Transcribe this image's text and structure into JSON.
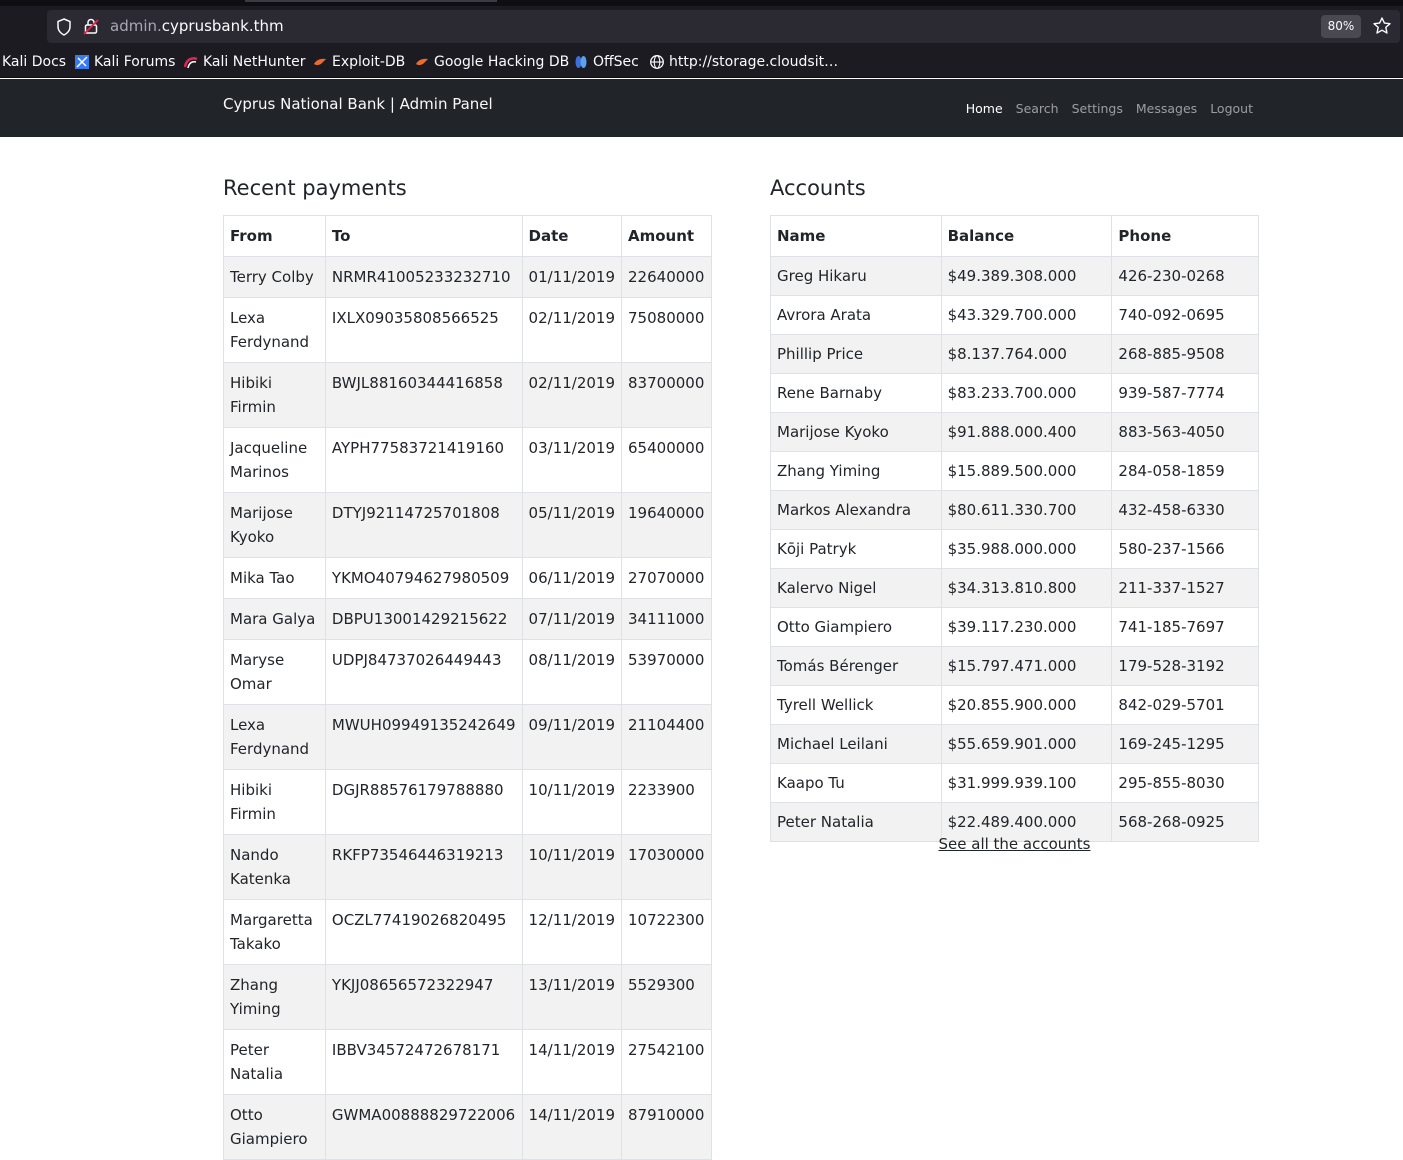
{
  "browser": {
    "url_prefix": "admin.",
    "url_domain": "cyprusbank.thm",
    "zoom": "80%",
    "bookmarks": [
      {
        "label": "Kali Docs",
        "icon": "kali-docs-icon"
      },
      {
        "label": "Kali Forums",
        "icon": "kali-forums-icon"
      },
      {
        "label": "Kali NetHunter",
        "icon": "kali-nethunter-icon"
      },
      {
        "label": "Exploit-DB",
        "icon": "exploit-db-icon"
      },
      {
        "label": "Google Hacking DB",
        "icon": "google-hacking-db-icon"
      },
      {
        "label": "OffSec",
        "icon": "offsec-icon"
      },
      {
        "label": "http://storage.cloudsit…",
        "icon": "globe-icon"
      }
    ]
  },
  "navbar": {
    "brand": "Cyprus National Bank | Admin Panel",
    "links": [
      "Home",
      "Search",
      "Settings",
      "Messages",
      "Logout"
    ],
    "active": "Home"
  },
  "payments": {
    "title": "Recent payments",
    "headers": [
      "From",
      "To",
      "Date",
      "Amount"
    ],
    "rows": [
      [
        "Terry Colby",
        "NRMR41005233232710",
        "01/11/2019",
        "22640000"
      ],
      [
        "Lexa Ferdynand",
        "IXLX09035808566525",
        "02/11/2019",
        "75080000"
      ],
      [
        "Hibiki Firmin",
        "BWJL88160344416858",
        "02/11/2019",
        "83700000"
      ],
      [
        "Jacqueline Marinos",
        "AYPH77583721419160",
        "03/11/2019",
        "65400000"
      ],
      [
        "Marijose Kyoko",
        "DTYJ92114725701808",
        "05/11/2019",
        "19640000"
      ],
      [
        "Mika Tao",
        "YKMO40794627980509",
        "06/11/2019",
        "27070000"
      ],
      [
        "Mara Galya",
        "DBPU13001429215622",
        "07/11/2019",
        "34111000"
      ],
      [
        "Maryse Omar",
        "UDPJ84737026449443",
        "08/11/2019",
        "53970000"
      ],
      [
        "Lexa Ferdynand",
        "MWUH09949135242649",
        "09/11/2019",
        "21104400"
      ],
      [
        "Hibiki Firmin",
        "DGJR88576179788880",
        "10/11/2019",
        "2233900"
      ],
      [
        "Nando Katenka",
        "RKFP73546446319213",
        "10/11/2019",
        "17030000"
      ],
      [
        "Margaretta Takako",
        "OCZL77419026820495",
        "12/11/2019",
        "10722300"
      ],
      [
        "Zhang Yiming",
        "YKJJ08656572322947",
        "13/11/2019",
        "5529300"
      ],
      [
        "Peter Natalia",
        "IBBV34572472678171",
        "14/11/2019",
        "27542100"
      ],
      [
        "Otto Giampiero",
        "GWMA00888829722006",
        "14/11/2019",
        "87910000"
      ]
    ]
  },
  "accounts": {
    "title": "Accounts",
    "headers": [
      "Name",
      "Balance",
      "Phone"
    ],
    "rows": [
      [
        "Greg Hikaru",
        "$49.389.308.000",
        "426-230-0268"
      ],
      [
        "Avrora Arata",
        "$43.329.700.000",
        "740-092-0695"
      ],
      [
        "Phillip Price",
        "$8.137.764.000",
        "268-885-9508"
      ],
      [
        "Rene Barnaby",
        "$83.233.700.000",
        "939-587-7774"
      ],
      [
        "Marijose Kyoko",
        "$91.888.000.400",
        "883-563-4050"
      ],
      [
        "Zhang Yiming",
        "$15.889.500.000",
        "284-058-1859"
      ],
      [
        "Markos Alexandra",
        "$80.611.330.700",
        "432-458-6330"
      ],
      [
        "Kōji Patryk",
        "$35.988.000.000",
        "580-237-1566"
      ],
      [
        "Kalervo Nigel",
        "$34.313.810.800",
        "211-337-1527"
      ],
      [
        "Otto Giampiero",
        "$39.117.230.000",
        "741-185-7697"
      ],
      [
        "Tomás Bérenger",
        "$15.797.471.000",
        "179-528-3192"
      ],
      [
        "Tyrell Wellick",
        "$20.855.900.000",
        "842-029-5701"
      ],
      [
        "Michael Leilani",
        "$55.659.901.000",
        "169-245-1295"
      ],
      [
        "Kaapo Tu",
        "$31.999.939.100",
        "295-855-8030"
      ],
      [
        "Peter Natalia",
        "$22.489.400.000",
        "568-268-0925"
      ]
    ],
    "see_all": "See all the accounts"
  }
}
